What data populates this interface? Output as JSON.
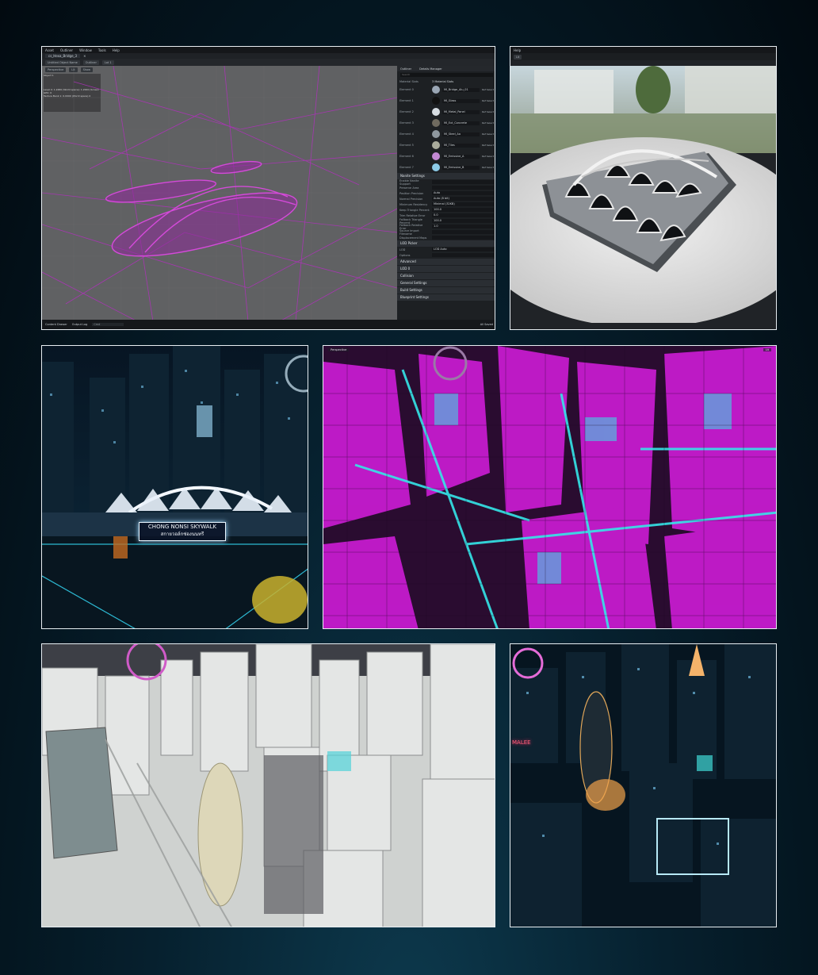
{
  "colors": {
    "accent": "#c02bc6",
    "cyan": "#35e6e8",
    "wire": "#b32fbf"
  },
  "panel1": {
    "menu": [
      "Asset",
      "Outliner",
      "Window",
      "Tools",
      "Help"
    ],
    "tab": "cs_Hexa_Bridge_3",
    "tab_close": "×",
    "toolbar": [
      "Perspective",
      "Lit",
      "Show"
    ],
    "top_toolbar": [
      "Untitled Object Name",
      "Outliner",
      "Lot 1"
    ],
    "overlay_lines": [
      "Object 1",
      "Level 0: 1.2480 (World space): 1.2000 (Screen",
      "GPU: 0",
      "Texture Bank 1: 0.0000 (World space) 0"
    ],
    "details": {
      "tabs": [
        "Outliner",
        "Details Manager"
      ],
      "search": "Search",
      "section_materials": "Material Slots",
      "material_header": "3 Material Slots",
      "elements": [
        {
          "label": "Element 0",
          "slot": "MI_Bridge_Alu_01",
          "mode": "Ref Select"
        },
        {
          "label": "Element 1",
          "slot": "MI_Glass",
          "mode": "Ref Select"
        },
        {
          "label": "Element 2",
          "slot": "MI_Metal_Panel",
          "mode": "Ref Select"
        },
        {
          "label": "Element 3",
          "slot": "MI_Ext_Concrete",
          "mode": "Ref Select"
        },
        {
          "label": "Element 4",
          "slot": "MI_Steel_Aa",
          "mode": "Ref Select"
        },
        {
          "label": "Element 5",
          "slot": "MI_Tiles",
          "mode": "Ref Select"
        },
        {
          "label": "Element 6",
          "slot": "MI_Emissive_A",
          "mode": "Ref Select"
        },
        {
          "label": "Element 7",
          "slot": "MI_Emissive_B",
          "mode": "Ref Select"
        }
      ],
      "section_nanite": "Nanite Settings",
      "nanite_rows": [
        {
          "label": "Enable Nanite Support",
          "val": ""
        },
        {
          "label": "Preserve Area",
          "val": ""
        },
        {
          "label": "Position Precision",
          "val": "Auto"
        },
        {
          "label": "Normal Precision",
          "val": "Auto (8 bit)"
        },
        {
          "label": "Minimum Residency",
          "val": "Minimal (32KB)"
        },
        {
          "label": "Keep Triangle Percent",
          "val": "100.0"
        },
        {
          "label": "Trim Relative Error",
          "val": "0.0"
        },
        {
          "label": "Fallback Triangle Percent",
          "val": "100.0"
        },
        {
          "label": "Fallback Relative Error",
          "val": "1.0"
        },
        {
          "label": "Source Import Filename",
          "val": ""
        },
        {
          "label": "Displacement Maps",
          "val": ""
        }
      ],
      "section_lod": "LOD Picker",
      "lod_rows": [
        {
          "label": "LOD",
          "val": "LOD Auto"
        },
        {
          "label": "Options",
          "val": ""
        }
      ],
      "collapsed": [
        "Advanced",
        "LOD 0",
        "Collision",
        "General Settings",
        "Build Settings",
        "Blueprint Settings"
      ],
      "status": "Content Browser"
    },
    "bottom": [
      "Content Drawer",
      "Output Log",
      "Cmd"
    ],
    "bottom_right": "All Saved"
  },
  "panel2": {
    "menu": "Help",
    "toolbar": "Lit"
  },
  "panel3": {
    "sign_line1": "CHONG NONSI SKYWALK",
    "sign_line2": "สกายวอล์กช่องนนทรี"
  },
  "panel4": {
    "toolbar_left": "Perspective",
    "toolbar_right": "Lit"
  },
  "panel5": {},
  "panel6": {
    "neon_left": "MALEE"
  }
}
